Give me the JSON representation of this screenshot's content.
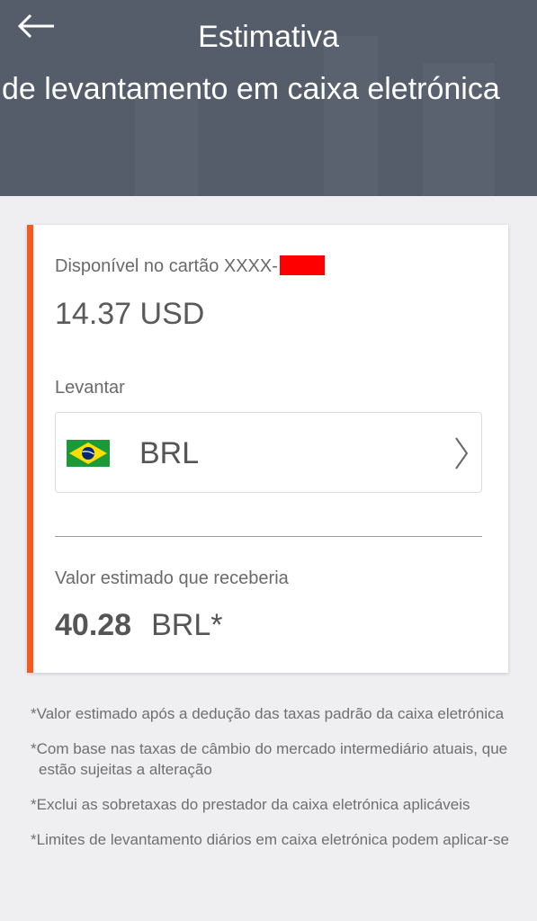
{
  "header": {
    "back_icon": "arrow-left-icon",
    "title_line1": "Estimativa",
    "title_line2": "de levantamento em caixa eletrónica"
  },
  "card": {
    "accent_color": "#f25a22",
    "available_label": "Disponível no cartão XXXX-",
    "available_amount": "14.37 USD",
    "withdraw_label": "Levantar",
    "currency": {
      "flag_icon": "brazil-flag-icon",
      "code": "BRL",
      "chevron_icon": "chevron-right-icon"
    },
    "estimate_label": "Valor estimado que receberia",
    "estimate_value": "40.28",
    "estimate_currency": "BRL*"
  },
  "notes": [
    "*Valor estimado após a dedução das taxas padrão da caixa eletrónica",
    "*Com base nas taxas de câmbio do mercado intermediário atuais, que estão sujeitas a alteração",
    "*Exclui as sobretaxas do prestador da caixa eletrónica aplicáveis",
    "*Limites de levantamento diários em caixa eletrónica podem aplicar-se"
  ]
}
